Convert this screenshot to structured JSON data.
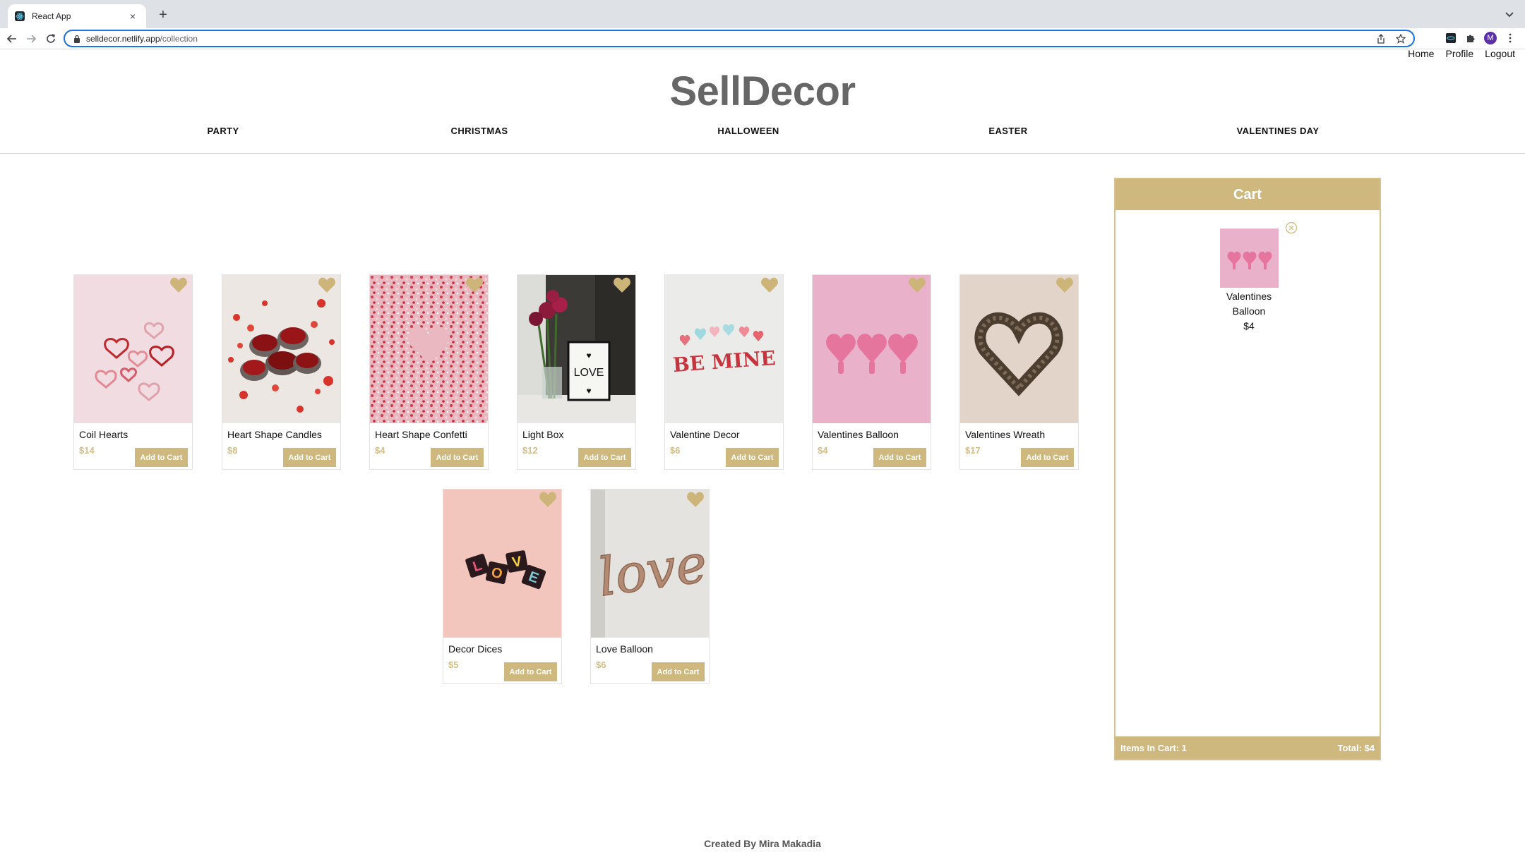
{
  "browser": {
    "tab_title": "React App",
    "tab_close": "×",
    "new_tab": "+",
    "url_host": "selldecor.netlify.app",
    "url_path": "/collection",
    "avatar_letter": "M"
  },
  "header": {
    "links": [
      "Home",
      "Profile",
      "Logout"
    ],
    "brand": "SellDecor",
    "categories": [
      "PARTY",
      "CHRISTMAS",
      "HALLOWEEN",
      "EASTER",
      "VALENTINES DAY"
    ]
  },
  "products": [
    {
      "name": "Coil Hearts",
      "price": "$14",
      "button": "Add to Cart"
    },
    {
      "name": "Heart Shape Candles",
      "price": "$8",
      "button": "Add to Cart"
    },
    {
      "name": "Heart Shape Confetti",
      "price": "$4",
      "button": "Add to Cart"
    },
    {
      "name": "Light Box",
      "price": "$12",
      "button": "Add to Cart"
    },
    {
      "name": "Valentine Decor",
      "price": "$6",
      "button": "Add to Cart"
    },
    {
      "name": "Valentines Balloon",
      "price": "$4",
      "button": "Add to Cart"
    },
    {
      "name": "Valentines Wreath",
      "price": "$17",
      "button": "Add to Cart"
    },
    {
      "name": "Decor Dices",
      "price": "$5",
      "button": "Add to Cart"
    },
    {
      "name": "Love Balloon",
      "price": "$6",
      "button": "Add to Cart"
    }
  ],
  "cart": {
    "title": "Cart",
    "items": [
      {
        "name": "Valentines Balloon",
        "price": "$4"
      }
    ],
    "items_count_label": "Items In Cart: 1",
    "total_label": "Total: $4"
  },
  "footer": {
    "credit": "Created By Mira Makadia"
  },
  "colors": {
    "accent": "#cfb87e",
    "heart": "#cdb57a",
    "brand_text": "#666666"
  },
  "icons": {
    "favorite": "heart-icon",
    "remove": "close-circle-icon",
    "lock": "lock-icon"
  }
}
